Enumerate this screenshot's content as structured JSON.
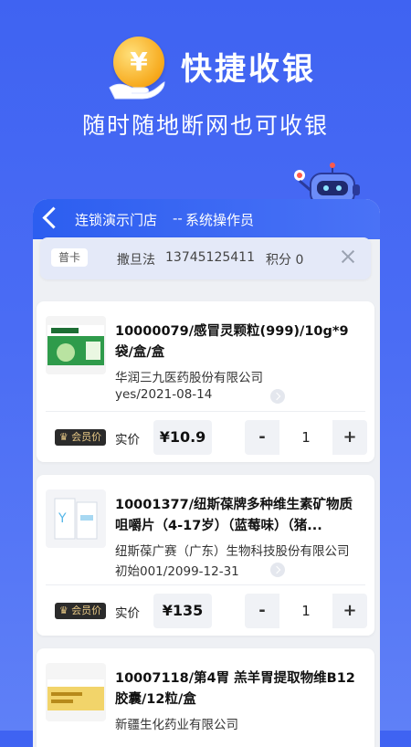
{
  "hero": {
    "coin_symbol": "¥",
    "title": "快捷收银",
    "subtitle": "随时随地断网也可收银"
  },
  "header": {
    "store": "连锁演示门店",
    "separator": "--",
    "operator": "系统操作员"
  },
  "member": {
    "card_type": "普卡",
    "name": "撒旦法",
    "phone": "13745125411",
    "points": "积分 0"
  },
  "products": [
    {
      "title": "10000079/感冒灵颗粒(999)/10g*9袋/盒/盒",
      "company": "华润三九医药股份有限公司",
      "batch": "yes/2021-08-14",
      "vip_label": "会员价",
      "price_label": "实价",
      "price": "¥10.9",
      "qty": "1",
      "minus": "-",
      "plus": "+"
    },
    {
      "title": "10001377/纽斯葆牌多种维生素矿物质咀嚼片（4-17岁）（蓝莓味）（猪...",
      "company": "纽斯葆广赛（广东）生物科技股份有限公司",
      "batch": "初始001/2099-12-31",
      "vip_label": "会员价",
      "price_label": "实价",
      "price": "¥135",
      "qty": "1",
      "minus": "-",
      "plus": "+"
    },
    {
      "title": "10007118/第4胃 羔羊胃提取物维B12胶囊/12粒/盒",
      "company": "新疆生化药业有限公司"
    }
  ],
  "colors": {
    "background": "#4a6cf4",
    "header": "#2c5ef0",
    "vip_badge": "#2b2b2b",
    "vip_text": "#e8c986"
  }
}
